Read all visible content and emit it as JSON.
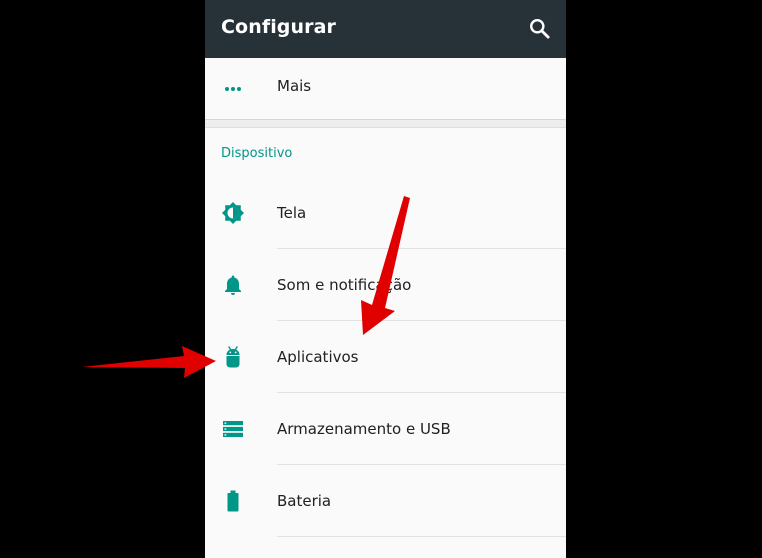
{
  "colors": {
    "appbar": "#263238",
    "accent": "#009688",
    "text": "#212121",
    "arrow": "#e00000"
  },
  "appbar": {
    "title": "Configurar",
    "search_icon": "search-icon"
  },
  "more_item": {
    "label": "Mais",
    "icon": "more-horiz-icon"
  },
  "section": {
    "header": "Dispositivo",
    "items": [
      {
        "label": "Tela",
        "icon": "brightness-icon"
      },
      {
        "label": "Som e notificação",
        "icon": "bell-icon"
      },
      {
        "label": "Aplicativos",
        "icon": "android-icon"
      },
      {
        "label": "Armazenamento e USB",
        "icon": "storage-icon"
      },
      {
        "label": "Bateria",
        "icon": "battery-icon"
      }
    ]
  },
  "annotations": [
    {
      "type": "arrow",
      "points_to": "Aplicativos",
      "from": "left"
    },
    {
      "type": "arrow",
      "points_to": "Aplicativos",
      "from": "top-right"
    }
  ]
}
